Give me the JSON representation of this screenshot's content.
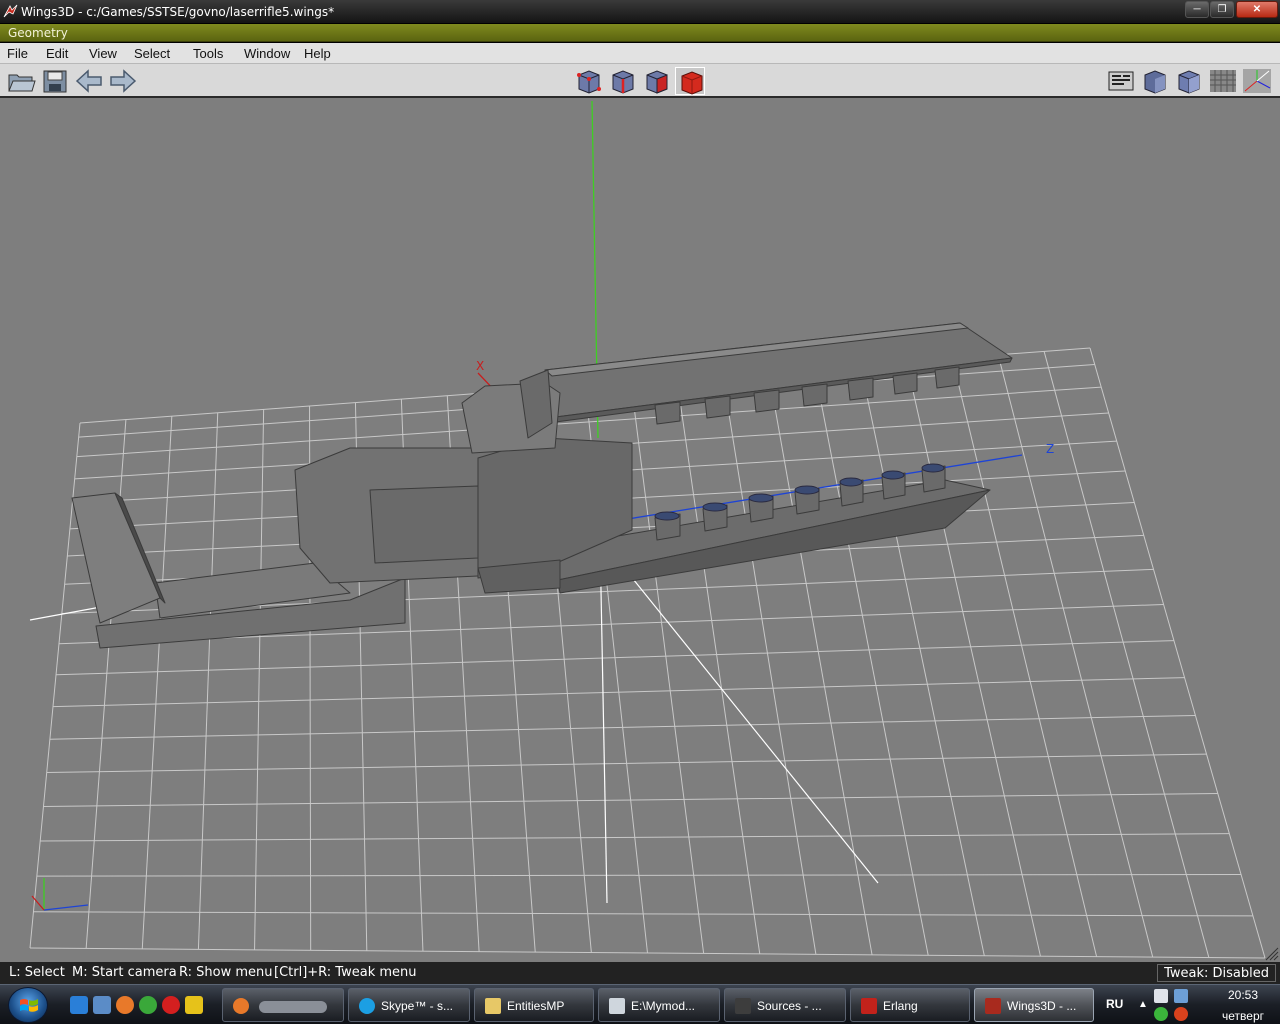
{
  "window": {
    "title": "Wings3D - c:/Games/SSTSE/govno/laserrifle5.wings*",
    "minimize_label": "─",
    "maximize_label": "❐",
    "close_label": "✕"
  },
  "geometry_header": "Geometry",
  "menu": [
    "File",
    "Edit",
    "View",
    "Select",
    "Tools",
    "Window",
    "Help"
  ],
  "toolbar": {
    "left": [
      "open-icon",
      "save-icon",
      "undo-icon",
      "redo-icon"
    ],
    "selection_modes": [
      "vertex-mode-icon",
      "edge-mode-icon",
      "face-mode-icon",
      "body-mode-icon"
    ],
    "active_mode": "body-mode-icon",
    "right": [
      "wireframe-icon",
      "smooth-shade-icon",
      "flat-shade-icon",
      "ground-plane-icon",
      "axes-icon"
    ]
  },
  "viewport": {
    "axis_x": "X",
    "axis_z": "Z",
    "background": "#7e7e7e",
    "grid_color": "#c8c8c8",
    "model_color": "#6e6e6e",
    "x_axis_color": "#c81e1e",
    "y_axis_color": "#3ecf23",
    "z_axis_color": "#1e44d6"
  },
  "status": {
    "hint_select": "L: Select",
    "hint_camera": "M: Start camera",
    "hint_menu": "R: Show menu",
    "hint_tweak": "[Ctrl]+R: Tweak menu",
    "tweak": "Tweak: Disabled"
  },
  "taskbar": {
    "tasks": [
      {
        "label": "",
        "icon": "firefox-icon"
      },
      {
        "label": "Skype™ - s...",
        "icon": "skype-icon"
      },
      {
        "label": "EntitiesMP",
        "icon": "folder-icon"
      },
      {
        "label": "E:\\Mymod...",
        "icon": "notepad-icon"
      },
      {
        "label": "Sources - ...",
        "icon": "sources-icon"
      },
      {
        "label": "Erlang",
        "icon": "erlang-icon"
      },
      {
        "label": "Wings3D - ...",
        "icon": "wings3d-icon"
      }
    ],
    "active_task": "Wings3D - ...",
    "language": "RU",
    "time": "20:53",
    "day": "четверг"
  }
}
